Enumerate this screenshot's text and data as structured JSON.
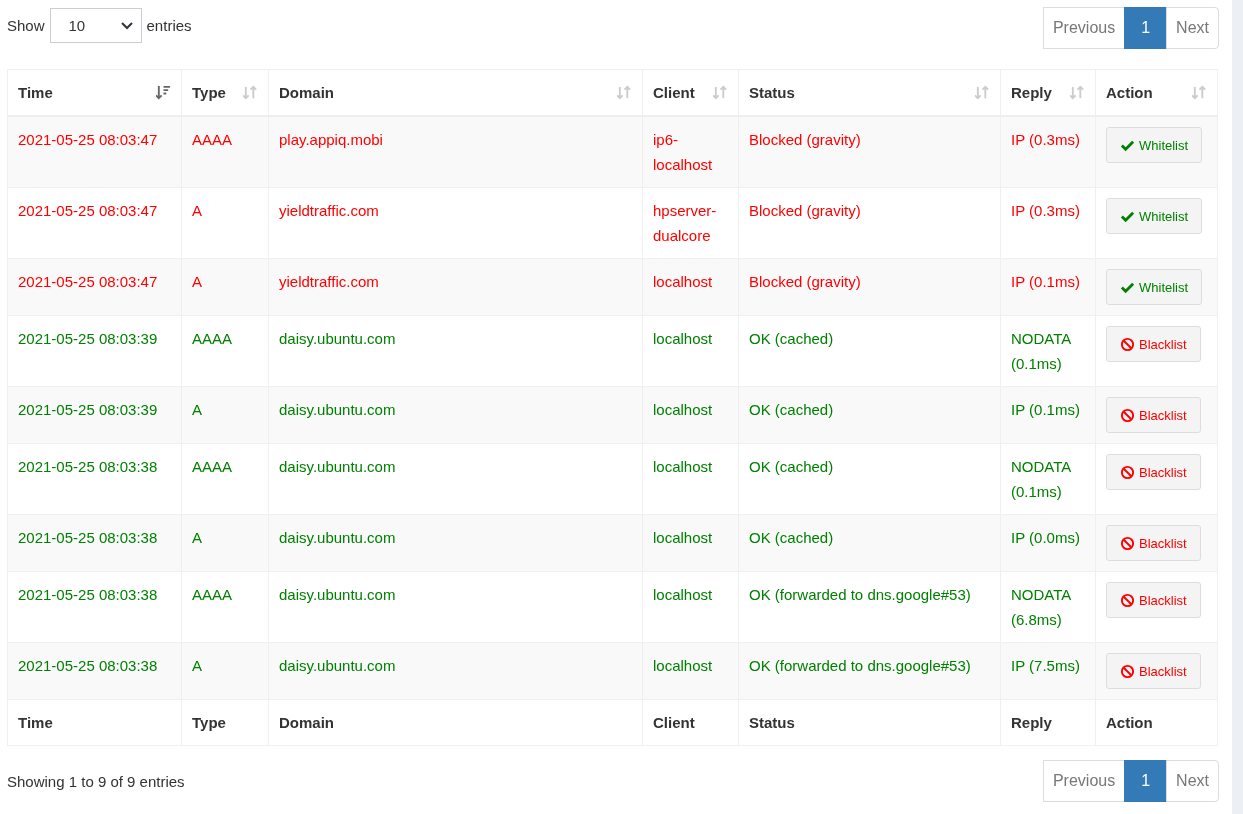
{
  "length_menu": {
    "before": "Show",
    "value": "10",
    "after": "entries"
  },
  "pagination_top": {
    "items": [
      {
        "label": "Previous",
        "disabled": true,
        "selected": false
      },
      {
        "label": "1",
        "disabled": false,
        "selected": true
      },
      {
        "label": "Next",
        "disabled": true,
        "selected": false
      }
    ]
  },
  "table": {
    "columns": [
      {
        "label": "Time",
        "sorted": true
      },
      {
        "label": "Type",
        "sorted": false
      },
      {
        "label": "Domain",
        "sorted": false
      },
      {
        "label": "Client",
        "sorted": false
      },
      {
        "label": "Status",
        "sorted": false
      },
      {
        "label": "Reply",
        "sorted": false
      },
      {
        "label": "Action",
        "sorted": false
      }
    ],
    "rows": [
      {
        "kind": "blocked",
        "time": "2021-05-25 08:03:47",
        "type": "AAAA",
        "domain": "play.appiq.mobi",
        "client": "ip6-localhost",
        "status": "Blocked (gravity)",
        "reply": "IP (0.3ms)",
        "action": "Whitelist"
      },
      {
        "kind": "blocked",
        "time": "2021-05-25 08:03:47",
        "type": "A",
        "domain": "yieldtraffic.com",
        "client": "hpserver-dualcore",
        "status": "Blocked (gravity)",
        "reply": "IP (0.3ms)",
        "action": "Whitelist"
      },
      {
        "kind": "blocked",
        "time": "2021-05-25 08:03:47",
        "type": "A",
        "domain": "yieldtraffic.com",
        "client": "localhost",
        "status": "Blocked (gravity)",
        "reply": "IP (0.1ms)",
        "action": "Whitelist"
      },
      {
        "kind": "ok",
        "time": "2021-05-25 08:03:39",
        "type": "AAAA",
        "domain": "daisy.ubuntu.com",
        "client": "localhost",
        "status": "OK (cached)",
        "reply": "NODATA (0.1ms)",
        "action": "Blacklist"
      },
      {
        "kind": "ok",
        "time": "2021-05-25 08:03:39",
        "type": "A",
        "domain": "daisy.ubuntu.com",
        "client": "localhost",
        "status": "OK (cached)",
        "reply": "IP (0.1ms)",
        "action": "Blacklist"
      },
      {
        "kind": "ok",
        "time": "2021-05-25 08:03:38",
        "type": "AAAA",
        "domain": "daisy.ubuntu.com",
        "client": "localhost",
        "status": "OK (cached)",
        "reply": "NODATA (0.1ms)",
        "action": "Blacklist"
      },
      {
        "kind": "ok",
        "time": "2021-05-25 08:03:38",
        "type": "A",
        "domain": "daisy.ubuntu.com",
        "client": "localhost",
        "status": "OK (cached)",
        "reply": "IP (0.0ms)",
        "action": "Blacklist"
      },
      {
        "kind": "ok",
        "time": "2021-05-25 08:03:38",
        "type": "AAAA",
        "domain": "daisy.ubuntu.com",
        "client": "localhost",
        "status": "OK (forwarded to dns.google#53)",
        "reply": "NODATA (6.8ms)",
        "action": "Blacklist"
      },
      {
        "kind": "ok",
        "time": "2021-05-25 08:03:38",
        "type": "A",
        "domain": "daisy.ubuntu.com",
        "client": "localhost",
        "status": "OK (forwarded to dns.google#53)",
        "reply": "IP (7.5ms)",
        "action": "Blacklist"
      }
    ],
    "footer": [
      "Time",
      "Type",
      "Domain",
      "Client",
      "Status",
      "Reply",
      "Action"
    ]
  },
  "info": "Showing 1 to 9 of 9 entries",
  "pagination_bottom": {
    "items": [
      {
        "label": "Previous",
        "disabled": true,
        "selected": false
      },
      {
        "label": "1",
        "disabled": false,
        "selected": true
      },
      {
        "label": "Next",
        "disabled": true,
        "selected": false
      }
    ]
  }
}
